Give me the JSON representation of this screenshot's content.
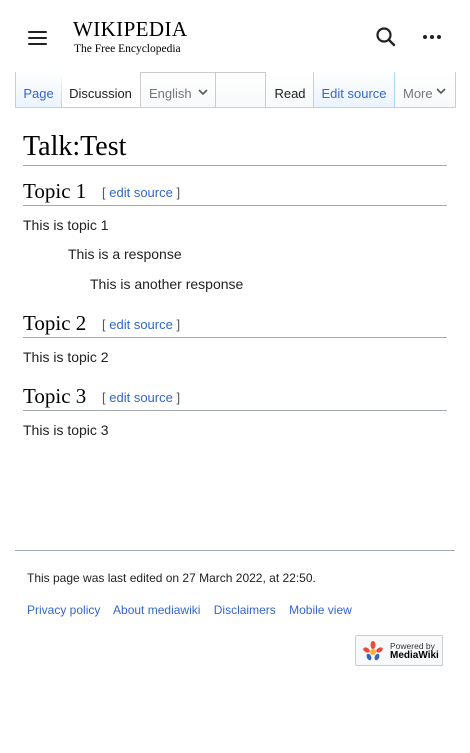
{
  "header": {
    "logo_word": "Wikipedia",
    "logo_tagline": "The Free Encyclopedia",
    "menu_icon": "hamburger-icon",
    "search_icon": "search-icon",
    "more_icon": "ellipsis-icon"
  },
  "tabs": {
    "page": "Page",
    "discussion": "Discussion",
    "language": "English",
    "read": "Read",
    "edit_source": "Edit source",
    "more": "More"
  },
  "page_title": "Talk:Test",
  "sections": [
    {
      "title": "Topic 1",
      "edit_bracket_open": "[",
      "edit_label": "edit source",
      "edit_bracket_close": "]",
      "body": "This is topic 1",
      "replies": [
        "This is a response",
        "This is another response"
      ]
    },
    {
      "title": "Topic 2",
      "edit_bracket_open": "[",
      "edit_label": "edit source",
      "edit_bracket_close": "]",
      "body": "This is topic 2"
    },
    {
      "title": "Topic 3",
      "edit_bracket_open": "[",
      "edit_label": "edit source",
      "edit_bracket_close": "]",
      "body": "This is topic 3"
    }
  ],
  "footer": {
    "last_modified": "This page was last edited on 27 March 2022, at 22:50.",
    "links": [
      "Privacy policy",
      "About mediawiki",
      "Disclaimers",
      "Mobile view"
    ],
    "powered_line1": "Powered by",
    "powered_line2": "MediaWiki"
  },
  "colors": {
    "link": "#3366cc",
    "text": "#202122",
    "tab_border": "#a7d7f9"
  }
}
